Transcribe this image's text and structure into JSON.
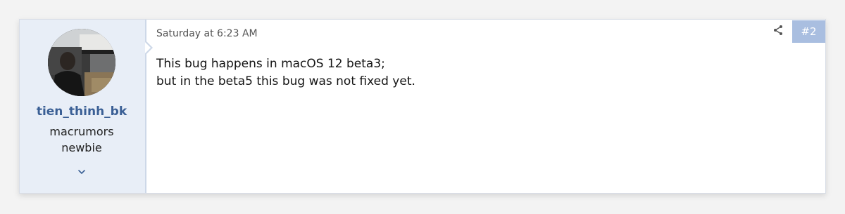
{
  "post": {
    "author": {
      "username": "tien_thinh_bk",
      "title_line1": "macrumors",
      "title_line2": "newbie",
      "avatar_icon": "user-avatar-photo",
      "expand_icon": "chevron-down-icon"
    },
    "date": "Saturday at 6:23 AM",
    "body_lines": [
      "This bug happens in macOS 12 beta3;",
      "but in the beta5 this bug was not fixed yet."
    ],
    "share_icon": "share-icon",
    "post_number": "#2"
  },
  "colors": {
    "page_background": "#f3f3f3",
    "user_panel_background": "#e8eef7",
    "username": "#3a5f95",
    "post_number_badge": "#a9bee0"
  }
}
